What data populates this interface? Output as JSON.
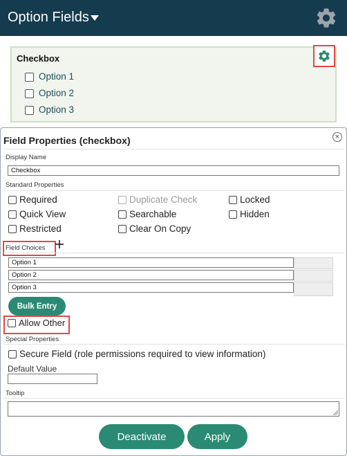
{
  "header": {
    "title": "Option Fields"
  },
  "preview": {
    "field_title": "Checkbox",
    "options": [
      "Option 1",
      "Option 2",
      "Option 3"
    ]
  },
  "dialog": {
    "title": "Field Properties (checkbox)",
    "close_label": "×",
    "display_name_label": "Display Name",
    "display_name_value": "Checkbox",
    "standard_properties_label": "Standard Properties",
    "standard_properties": [
      {
        "label": "Required",
        "checked": false,
        "disabled": false
      },
      {
        "label": "Duplicate Check",
        "checked": false,
        "disabled": true
      },
      {
        "label": "Locked",
        "checked": false,
        "disabled": false
      },
      {
        "label": "Quick View",
        "checked": false,
        "disabled": false
      },
      {
        "label": "Searchable",
        "checked": false,
        "disabled": false
      },
      {
        "label": "Hidden",
        "checked": false,
        "disabled": false
      },
      {
        "label": "Restricted",
        "checked": false,
        "disabled": false
      },
      {
        "label": "Clear On Copy",
        "checked": false,
        "disabled": false
      }
    ],
    "field_choices_label": "Field Choices",
    "field_choices": [
      "Option 1",
      "Option 2",
      "Option 3"
    ],
    "bulk_entry_label": "Bulk Entry",
    "allow_other_label": "Allow Other",
    "special_properties_label": "Special Properties",
    "secure_field_label": "Secure Field (role permissions required to view information)",
    "default_value_label": "Default Value",
    "default_value": "",
    "tooltip_label": "Tooltip",
    "tooltip_value": "",
    "deactivate_label": "Deactivate",
    "apply_label": "Apply"
  },
  "colors": {
    "header_bg": "#153b4f",
    "accent_green": "#2b8a73",
    "highlight_red": "#e04848",
    "card_bg": "#f1f5ee"
  },
  "icons": [
    "gear-icon",
    "caret-down-icon",
    "close-icon",
    "resize-handle-icon"
  ]
}
